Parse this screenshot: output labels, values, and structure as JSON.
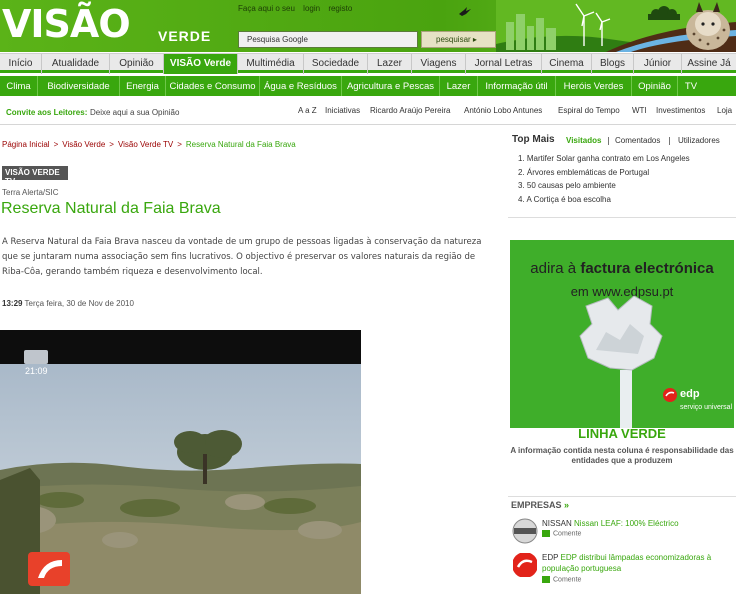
{
  "header": {
    "logo": "VISÃO",
    "logo_sub": "VERDE",
    "top_links": [
      "Faça aqui o seu",
      "login",
      "registo"
    ],
    "search_placeholder": "Pesquisa Google",
    "search_button": "pesquisar ▸"
  },
  "main_nav": [
    {
      "label": "Início",
      "active": false
    },
    {
      "label": "Atualidade",
      "active": false
    },
    {
      "label": "Opinião",
      "active": false
    },
    {
      "label": "VISÃO Verde",
      "active": true
    },
    {
      "label": "Multimédia",
      "active": false
    },
    {
      "label": "Sociedade",
      "active": false
    },
    {
      "label": "Lazer",
      "active": false
    },
    {
      "label": "Viagens",
      "active": false
    },
    {
      "label": "Jornal Letras",
      "active": false
    },
    {
      "label": "Cinema",
      "active": false
    },
    {
      "label": "Blogs",
      "active": false
    },
    {
      "label": "Júnior",
      "active": false
    },
    {
      "label": "Assine Já",
      "active": false
    }
  ],
  "sub_nav": [
    "Clima",
    "Biodiversidade",
    "Energia",
    "Cidades e Consumo",
    "Água e Resíduos",
    "Agricultura e Pescas",
    "Lazer",
    "Informação útil",
    "Heróis Verdes",
    "Opinião",
    "TV"
  ],
  "tertiary": {
    "convite_label": "Convite aos Leitores:",
    "convite_text": "Deixe aqui a sua Opinião",
    "links": [
      "A a Z",
      "Iniciativas",
      "Ricardo Araújo Pereira",
      "António Lobo Antunes",
      "Espiral do Tempo",
      "WTI",
      "Investimentos",
      "Loja"
    ]
  },
  "breadcrumb": [
    "Página Inicial",
    "Visão Verde",
    "Visão Verde TV",
    "Reserva Natural da Faia Brava"
  ],
  "article": {
    "tag": "VISÃO VERDE TV",
    "source": "Terra Alerta/SIC",
    "title": "Reserva Natural da Faia Brava",
    "lead": "A Reserva Natural da Faia Brava nasceu da vontade de um grupo de pessoas ligadas à conservação da natureza que se juntaram numa associação sem fins lucrativos. O objectivo é preservar os valores naturais da região de Riba-Côa, gerando também riqueza e desenvolvimento local.",
    "time": "13:29",
    "date": "Terça feira, 30 de Nov de 2010",
    "video_clock": "21:09"
  },
  "top_mais": {
    "title": "Top Mais",
    "tabs": [
      {
        "label": "Visitados",
        "selected": true
      },
      {
        "label": "Comentados",
        "selected": false
      },
      {
        "label": "Utilizadores",
        "selected": false
      }
    ],
    "items": [
      "1. Martifer Solar ganha contrato em Los Angeles",
      "2. Árvores emblemáticas de Portugal",
      "3. 50 causas pelo ambiente",
      "4. A Cortiça é boa escolha"
    ]
  },
  "ad": {
    "line1_a": "adira à",
    "line1_b": "factura electrónica",
    "line2": "em www.edpsu.pt",
    "brand": "edp",
    "brand_sub": "serviço universal"
  },
  "linha_verde": {
    "title": "LINHA VERDE",
    "text": "A informação contida nesta coluna é responsabilidade das entidades que a produzem"
  },
  "empresas": {
    "title": "EMPRESAS",
    "arrow": "»",
    "items": [
      {
        "company": "NISSAN",
        "headline": "Nissan LEAF: 100% Eléctrico",
        "comment": "Comente"
      },
      {
        "company": "EDP",
        "headline": "EDP distribui lâmpadas economizadoras à população portuguesa",
        "comment": "Comente"
      }
    ]
  },
  "colors": {
    "brand_green": "#39a70e",
    "breadcrumb_red": "#9a0000"
  }
}
